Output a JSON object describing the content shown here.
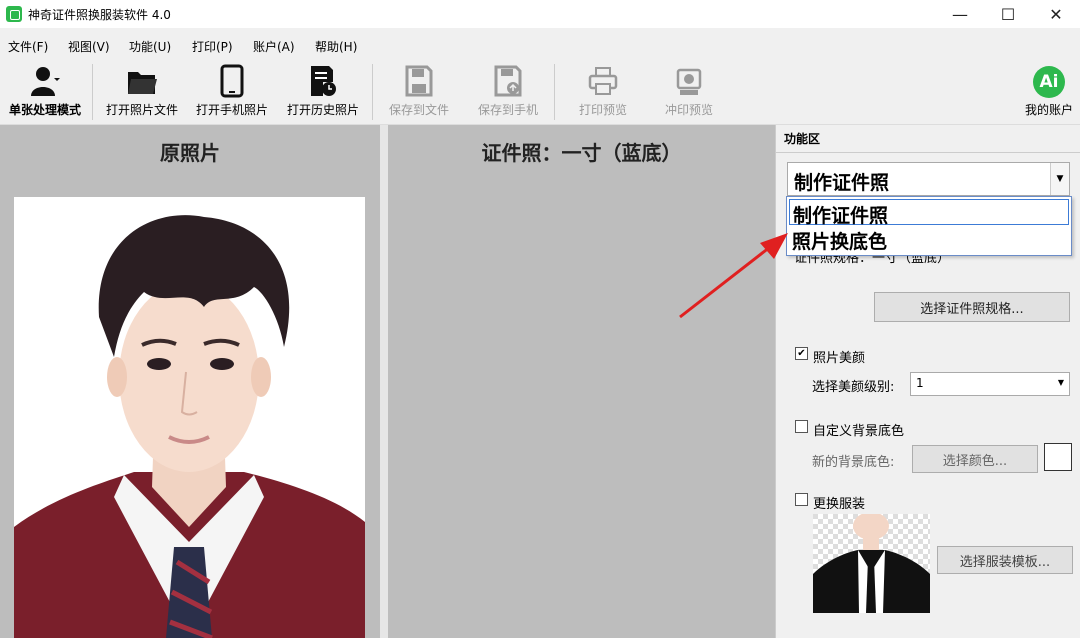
{
  "window": {
    "title": "神奇证件照换服装软件 4.0",
    "minimize": "—",
    "maximize": "☐",
    "close": "✕"
  },
  "menu": [
    "文件(F)",
    "视图(V)",
    "功能(U)",
    "打印(P)",
    "账户(A)",
    "帮助(H)"
  ],
  "toolbar": {
    "single_mode": "单张处理模式",
    "open_photo": "打开照片文件",
    "open_phone": "打开手机照片",
    "open_history": "打开历史照片",
    "save_file": "保存到文件",
    "save_phone": "保存到手机",
    "print_preview": "打印预览",
    "develop_preview": "冲印预览",
    "account": "我的账户",
    "account_badge": "Ai"
  },
  "left": {
    "title": "原照片"
  },
  "middle": {
    "title": "证件照：一寸（蓝底）"
  },
  "right": {
    "section_title": "功能区",
    "combo_value": "制作证件照",
    "dropdown_options": [
      "制作证件照",
      "照片换底色"
    ],
    "spec_label": "证件照规格：一寸（蓝底）",
    "choose_spec_button": "选择证件照规格...",
    "beauty_label": "照片美颜",
    "beauty_checked": "✔",
    "beauty_level_label": "选择美颜级别:",
    "beauty_level_value": "1",
    "custom_bg_label": "自定义背景底色",
    "new_bg_label": "新的背景底色:",
    "choose_color_button": "选择颜色...",
    "change_outfit_label": "更换服装",
    "choose_outfit_button": "选择服装模板..."
  },
  "colors": {
    "accent_green": "#2db84d",
    "arrow_red": "#e02020",
    "panel_gray": "#bdbdbd"
  }
}
